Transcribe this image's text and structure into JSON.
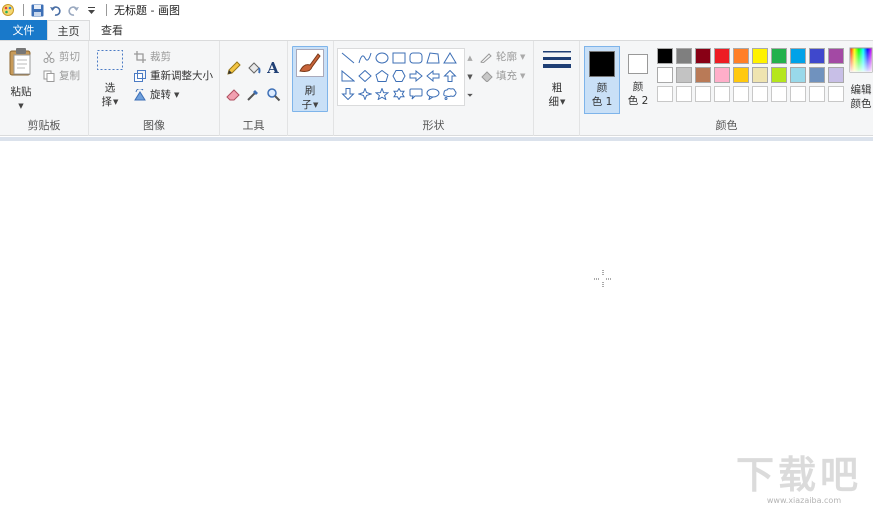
{
  "window": {
    "title": "无标题 - 画图"
  },
  "quick_access": {
    "app_icon": "paint-app-icon",
    "save_icon": "save-icon",
    "undo_icon": "undo-icon",
    "redo_icon": "redo-icon",
    "customize_icon": "customize-dropdown-icon"
  },
  "tabs": {
    "file": "文件",
    "home": "主页",
    "view": "查看"
  },
  "groups": {
    "clipboard": {
      "label": "剪贴板",
      "paste": "粘贴",
      "cut": "剪切",
      "copy": "复制"
    },
    "image": {
      "label": "图像",
      "select_line1": "选",
      "select_line2": "择",
      "crop": "裁剪",
      "resize": "重新调整大小",
      "rotate": "旋转"
    },
    "tools": {
      "label": "工具",
      "items": [
        "pencil-icon",
        "fill-icon",
        "text-icon",
        "eraser-icon",
        "color-picker-icon",
        "magnifier-icon"
      ]
    },
    "brushes": {
      "line1": "刷",
      "line2": "子"
    },
    "shapes": {
      "label": "形状",
      "outline": "轮廓",
      "fill": "填充",
      "items": [
        "line",
        "curve",
        "oval",
        "rectangle",
        "rounded-rectangle",
        "polygon",
        "triangle",
        "right-triangle",
        "diamond",
        "pentagon",
        "hexagon",
        "right-arrow",
        "left-arrow",
        "up-arrow",
        "down-arrow",
        "four-point-star",
        "five-point-star",
        "six-point-star",
        "rounded-callout",
        "oval-callout",
        "cloud-callout"
      ]
    },
    "size": {
      "line1": "粗",
      "line2": "细"
    },
    "colors": {
      "label": "颜色",
      "color1_line1": "颜",
      "color1_line2": "色 1",
      "color2_line1": "颜",
      "color2_line2": "色 2",
      "edit_line1": "编辑",
      "edit_line2": "颜色",
      "color1_value": "#000000",
      "color2_value": "#ffffff",
      "palette_row1": [
        "#000000",
        "#7f7f7f",
        "#880015",
        "#ed1c24",
        "#ff7f27",
        "#fff200",
        "#22b14c",
        "#00a2e8",
        "#3f48cc",
        "#a349a4"
      ],
      "palette_row2": [
        "#ffffff",
        "#c3c3c3",
        "#b97a57",
        "#ffaec9",
        "#ffc90e",
        "#efe4b0",
        "#b5e61d",
        "#99d9ea",
        "#7092be",
        "#c8bfe7"
      ],
      "palette_row3": [
        "#ffffff",
        "#ffffff",
        "#ffffff",
        "#ffffff",
        "#ffffff",
        "#ffffff",
        "#ffffff",
        "#ffffff",
        "#ffffff",
        "#ffffff"
      ]
    }
  },
  "watermark": {
    "text": "下载吧",
    "url": "www.xiazaiba.com"
  }
}
